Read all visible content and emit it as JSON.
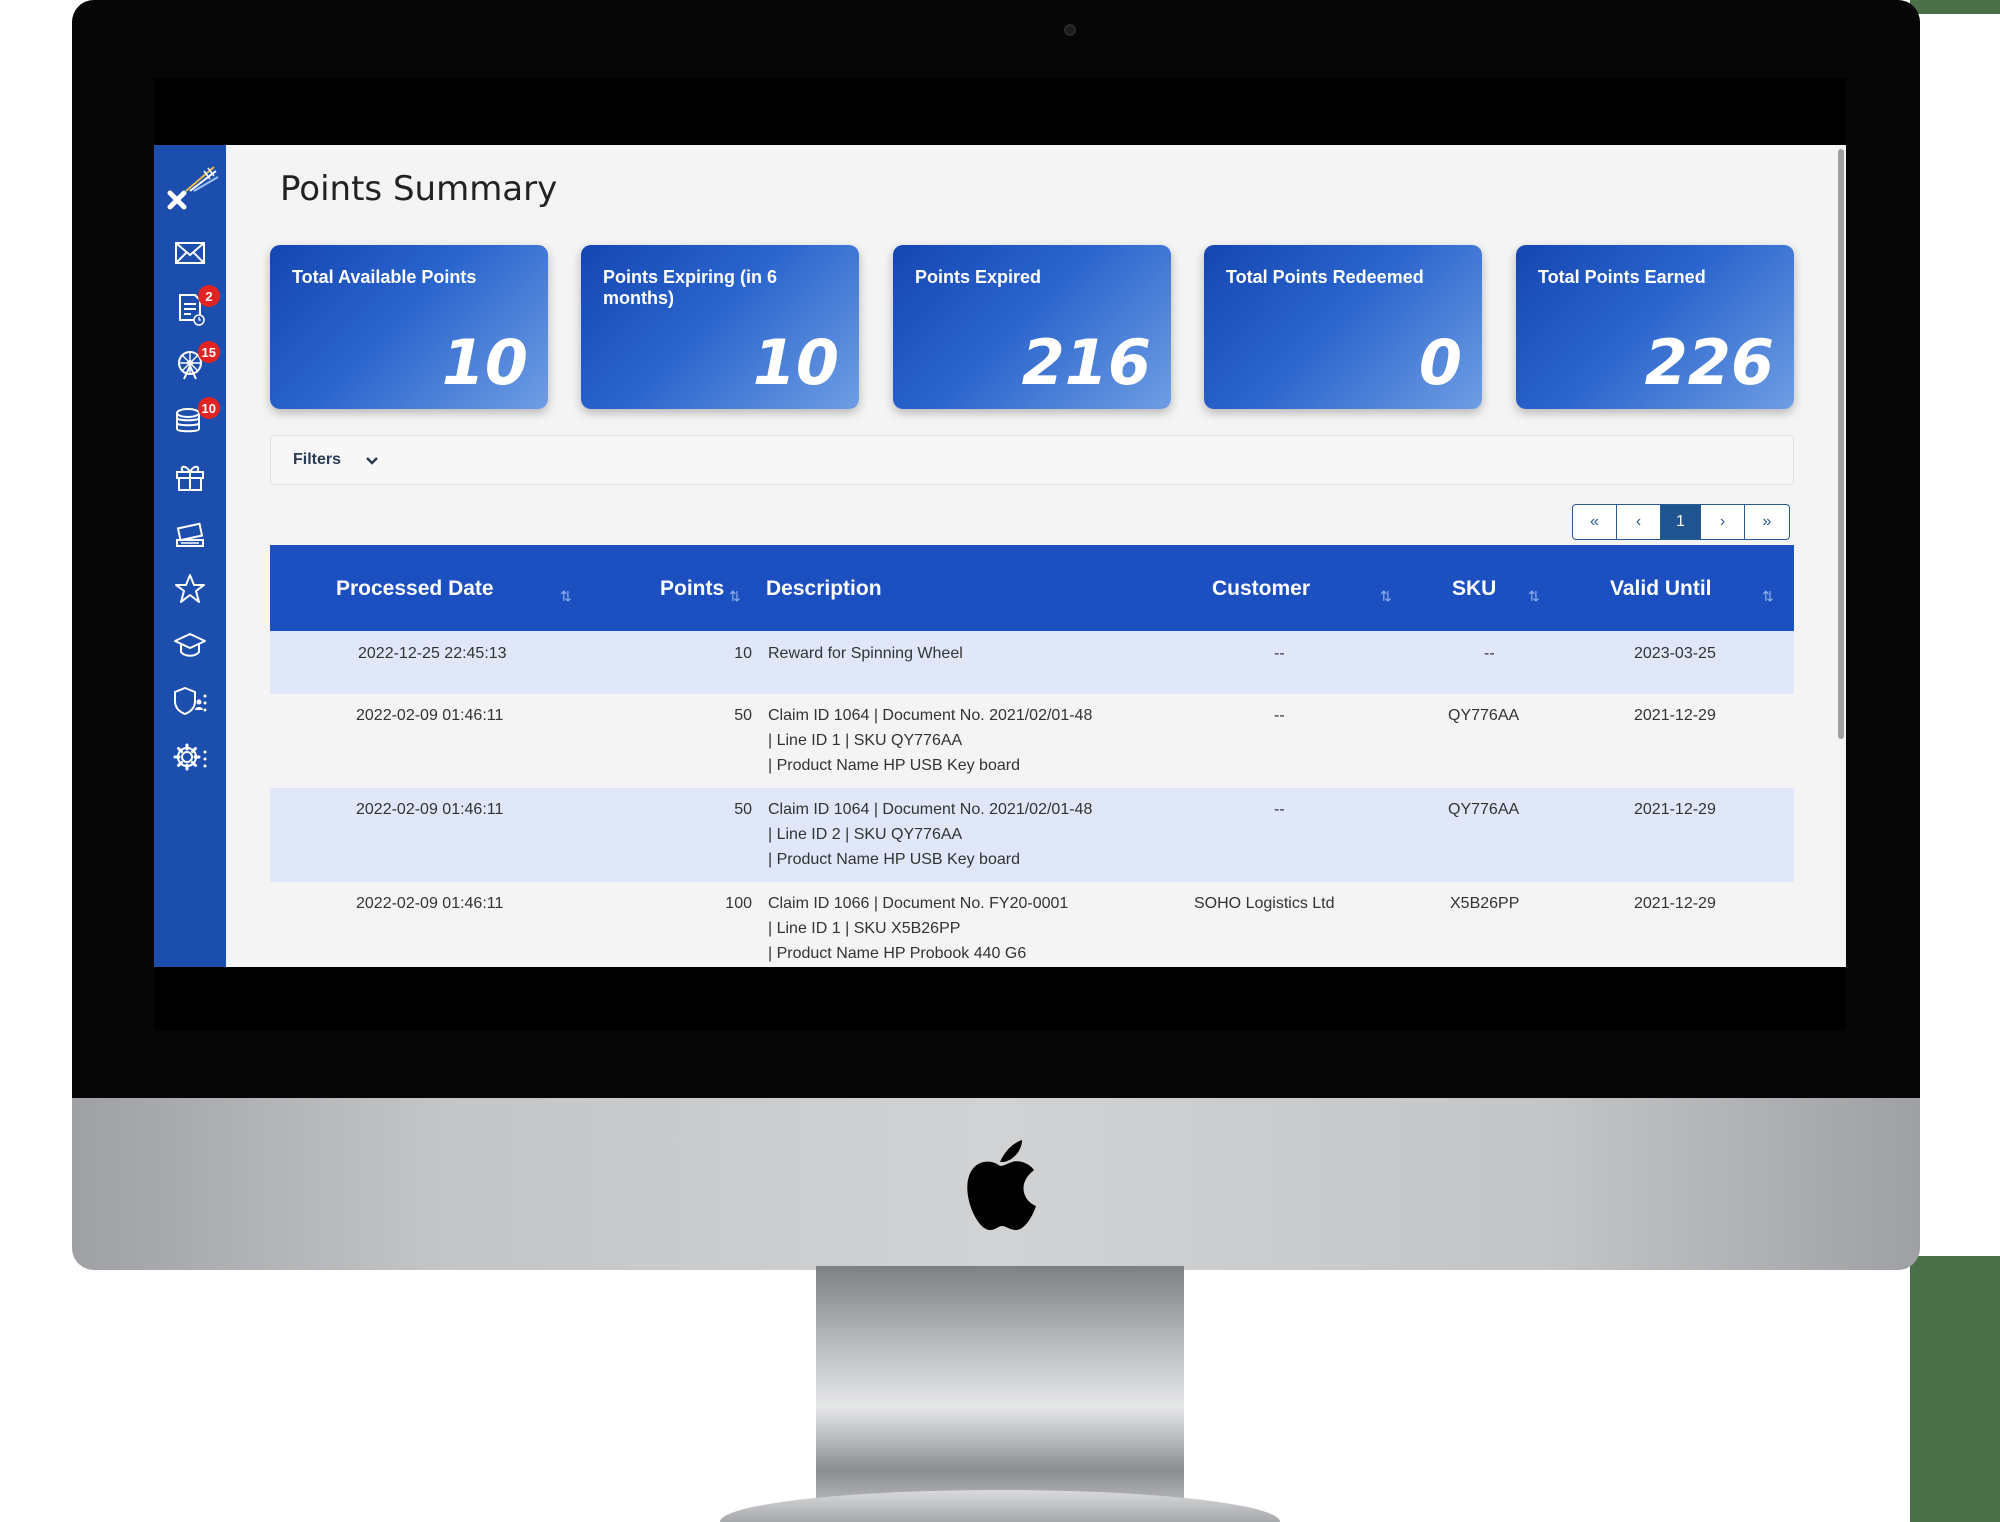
{
  "app": {
    "page_title": "Points Summary",
    "cards": [
      {
        "label": "Total Available Points",
        "value": "10"
      },
      {
        "label": "Points Expiring (in 6 months)",
        "value": "10"
      },
      {
        "label": "Points Expired",
        "value": "216"
      },
      {
        "label": "Total Points Redeemed",
        "value": "0"
      },
      {
        "label": "Total Points Earned",
        "value": "226"
      }
    ],
    "filters_label": "Filters",
    "pager": {
      "first": "«",
      "prev": "‹",
      "current": "1",
      "next": "›",
      "last": "»"
    },
    "table": {
      "headers": {
        "processed_date": "Processed Date",
        "points": "Points",
        "description": "Description",
        "customer": "Customer",
        "sku": "SKU",
        "valid_until": "Valid Until"
      },
      "rows": [
        {
          "date": "2022-12-25 22:45:13",
          "points": "10",
          "desc1": "Reward for Spinning Wheel",
          "desc2": "",
          "desc3": "",
          "customer": "--",
          "sku": "--",
          "valid": "2023-03-25"
        },
        {
          "date": "2022-02-09 01:46:11",
          "points": "50",
          "desc1": "Claim ID 1064 | Document No. 2021/02/01-48",
          "desc2": "| Line ID 1 | SKU QY776AA",
          "desc3": "| Product Name HP USB Key board",
          "customer": "--",
          "sku": "QY776AA",
          "valid": "2021-12-29"
        },
        {
          "date": "2022-02-09 01:46:11",
          "points": "50",
          "desc1": "Claim ID 1064 | Document No. 2021/02/01-48",
          "desc2": "| Line ID 2 | SKU QY776AA",
          "desc3": "| Product Name HP USB Key board",
          "customer": "--",
          "sku": "QY776AA",
          "valid": "2021-12-29"
        },
        {
          "date": "2022-02-09 01:46:11",
          "points": "100",
          "desc1": "Claim ID 1066 | Document No. FY20-0001",
          "desc2": "| Line ID 1 | SKU X5B26PP",
          "desc3": "| Product Name HP Probook 440 G6",
          "customer": "SOHO Logistics Ltd",
          "sku": "X5B26PP",
          "valid": "2021-12-29"
        }
      ]
    }
  },
  "sidebar": {
    "items": [
      {
        "icon": "mail-icon",
        "badge": ""
      },
      {
        "icon": "document-clock-icon",
        "badge": "2"
      },
      {
        "icon": "ferris-wheel-icon",
        "badge": "15"
      },
      {
        "icon": "coins-icon",
        "badge": "10"
      },
      {
        "icon": "gift-icon",
        "badge": ""
      },
      {
        "icon": "ticket-hand-icon",
        "badge": ""
      },
      {
        "icon": "star-icon",
        "badge": ""
      },
      {
        "icon": "graduation-cap-icon",
        "badge": ""
      },
      {
        "icon": "shield-user-icon",
        "badge": ""
      },
      {
        "icon": "gear-icon",
        "badge": ""
      }
    ]
  },
  "colors": {
    "sidebar": "#1c4fad",
    "card_gradient_start": "#1546b2",
    "card_gradient_end": "#6f9ee4",
    "table_header": "#1c4fc0",
    "row_alt": "#dfe7f9",
    "badge": "#e02424"
  }
}
